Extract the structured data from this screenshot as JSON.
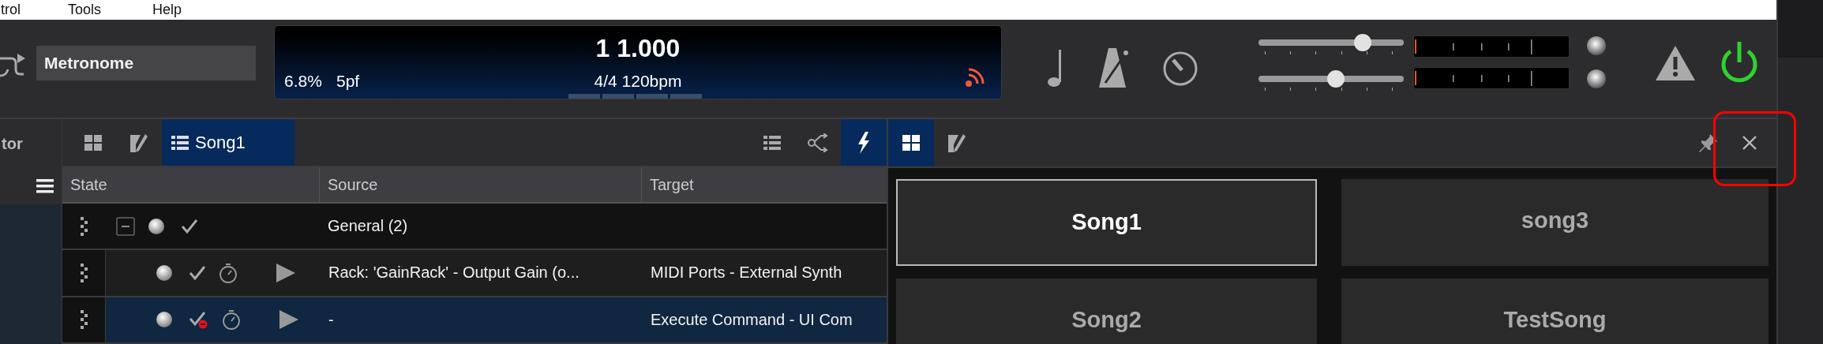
{
  "menu": [
    "trol",
    "Tools",
    "Help"
  ],
  "toolbar": {
    "preset": "Metronome",
    "display": {
      "position": "1 1.000",
      "cpu": "6.8%",
      "patch": "5pf",
      "signature": "4/4 120bpm"
    },
    "sliders": [
      {
        "level": 0.72
      },
      {
        "level": 0.53
      }
    ]
  },
  "left_pane": {
    "title": "tor"
  },
  "song_tabs": [
    {
      "kind": "grid",
      "selected": false
    },
    {
      "kind": "edit",
      "selected": false
    },
    {
      "kind": "list",
      "label": "Song1",
      "selected": true
    }
  ],
  "tools": [
    {
      "kind": "list",
      "selected": false
    },
    {
      "kind": "share",
      "selected": false
    },
    {
      "kind": "lightning",
      "selected": true
    }
  ],
  "table": {
    "columns": [
      "State",
      "Source",
      "Target"
    ],
    "rows": [
      {
        "kind": "group",
        "expanded": true,
        "source": "General (2)",
        "selected": false
      },
      {
        "kind": "item",
        "source": "Rack: 'GainRack' - Output Gain (o...",
        "target": "MIDI Ports - External Synth",
        "error": false,
        "selected": false
      },
      {
        "kind": "item",
        "source": "-",
        "target": "Execute Command - UI Com",
        "error": true,
        "selected": true
      }
    ]
  },
  "panel_tabs": [
    {
      "kind": "grid",
      "selected": true
    },
    {
      "kind": "edit",
      "selected": false
    }
  ],
  "songs": [
    {
      "label": "Song1",
      "selected": true
    },
    {
      "label": "song3",
      "selected": false
    },
    {
      "label": "Song2",
      "selected": false
    },
    {
      "label": "TestSong",
      "selected": false
    }
  ]
}
